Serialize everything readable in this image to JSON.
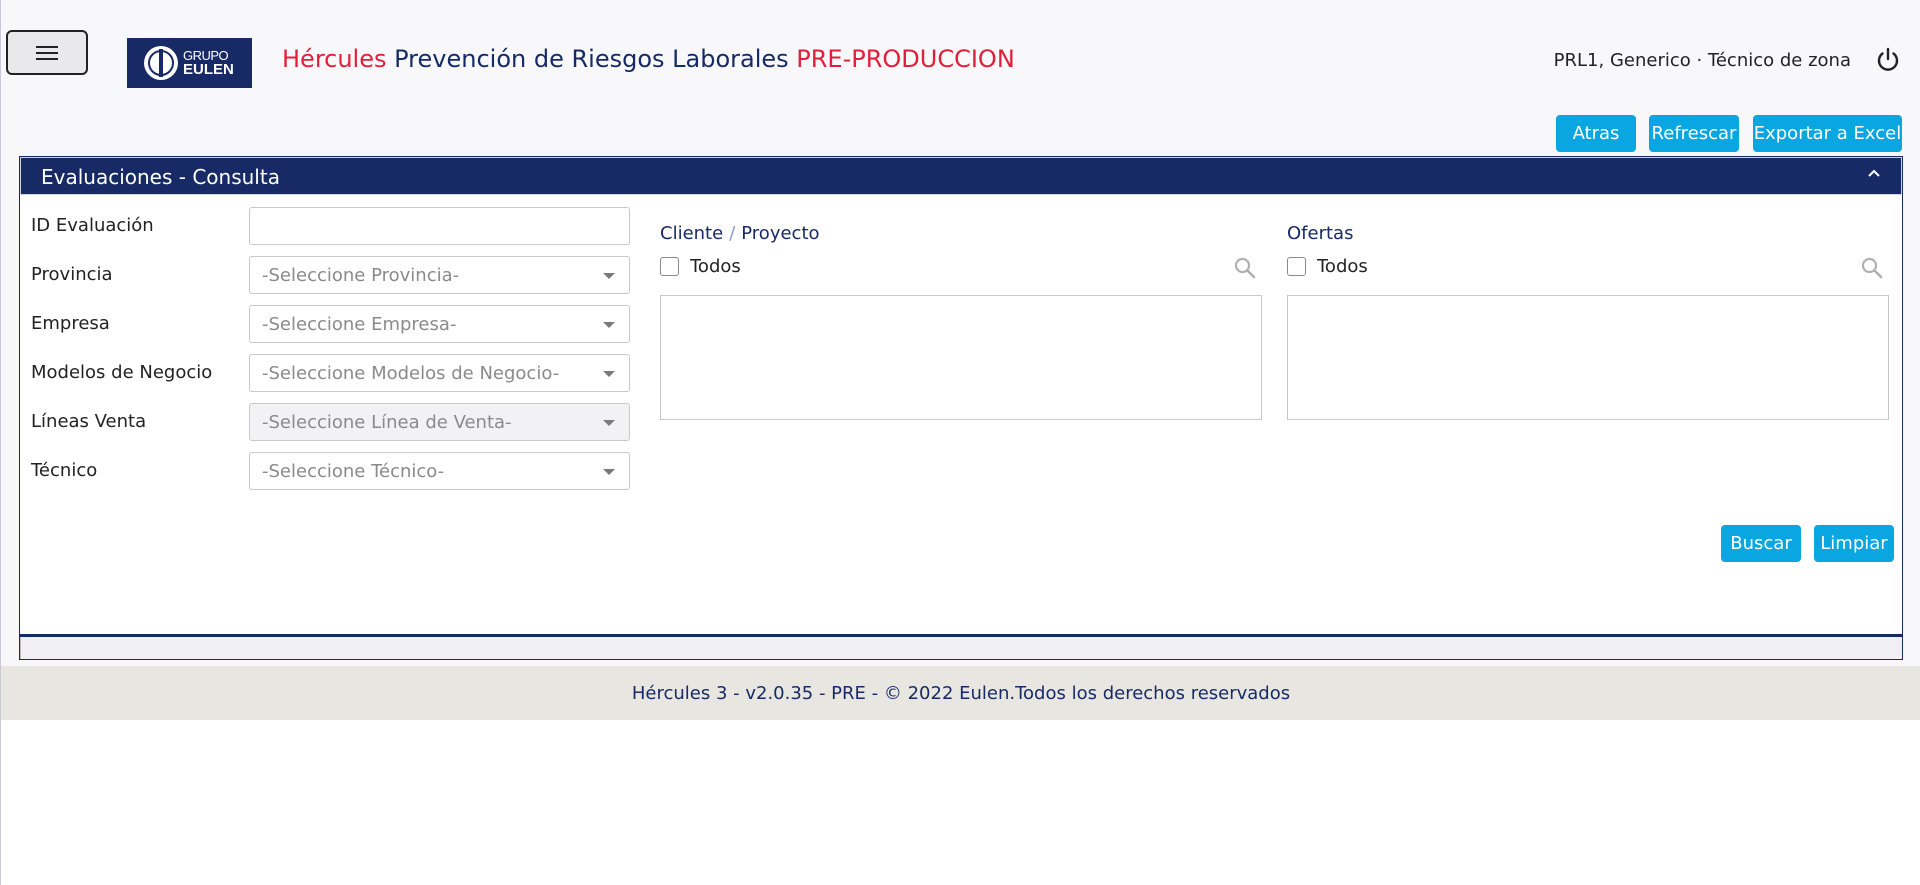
{
  "header": {
    "logo": {
      "line1": "GRUPO",
      "line2": "EULEN"
    },
    "title_part1": "Hércules",
    "title_part2": " Prevención de Riesgos Laborales ",
    "title_part3": "PRE-PRODUCCION",
    "user": "PRL1, Generico · Técnico de zona"
  },
  "toolbar": {
    "back_label": "Atras",
    "refresh_label": "Refrescar",
    "export_label": "Exportar a Excel"
  },
  "panel": {
    "title": "Evaluaciones - Consulta"
  },
  "form": {
    "id_label": "ID Evaluación",
    "id_value": "",
    "province_label": "Provincia",
    "province_placeholder": "-Seleccione Provincia-",
    "company_label": "Empresa",
    "company_placeholder": "-Seleccione Empresa-",
    "business_label": "Modelos de Negocio",
    "business_placeholder": "-Seleccione Modelos de Negocio-",
    "saleslines_label": "Líneas Venta",
    "saleslines_placeholder": "-Seleccione Línea de Venta-",
    "technician_label": "Técnico",
    "technician_placeholder": "-Seleccione Técnico-"
  },
  "client_project": {
    "title_a": "Cliente",
    "separator": "/",
    "title_b": "Proyecto",
    "all_label": "Todos",
    "all_checked": false
  },
  "offers": {
    "title": "Ofertas",
    "all_label": "Todos",
    "all_checked": false
  },
  "actions": {
    "search_label": "Buscar",
    "clear_label": "Limpiar"
  },
  "footer": {
    "text": "Hércules 3 - v2.0.35 - PRE - © 2022 Eulen.Todos los derechos reservados"
  },
  "colors": {
    "navy": "#172a66",
    "accent": "#0aa6e2",
    "brand_red": "#e0203a"
  }
}
